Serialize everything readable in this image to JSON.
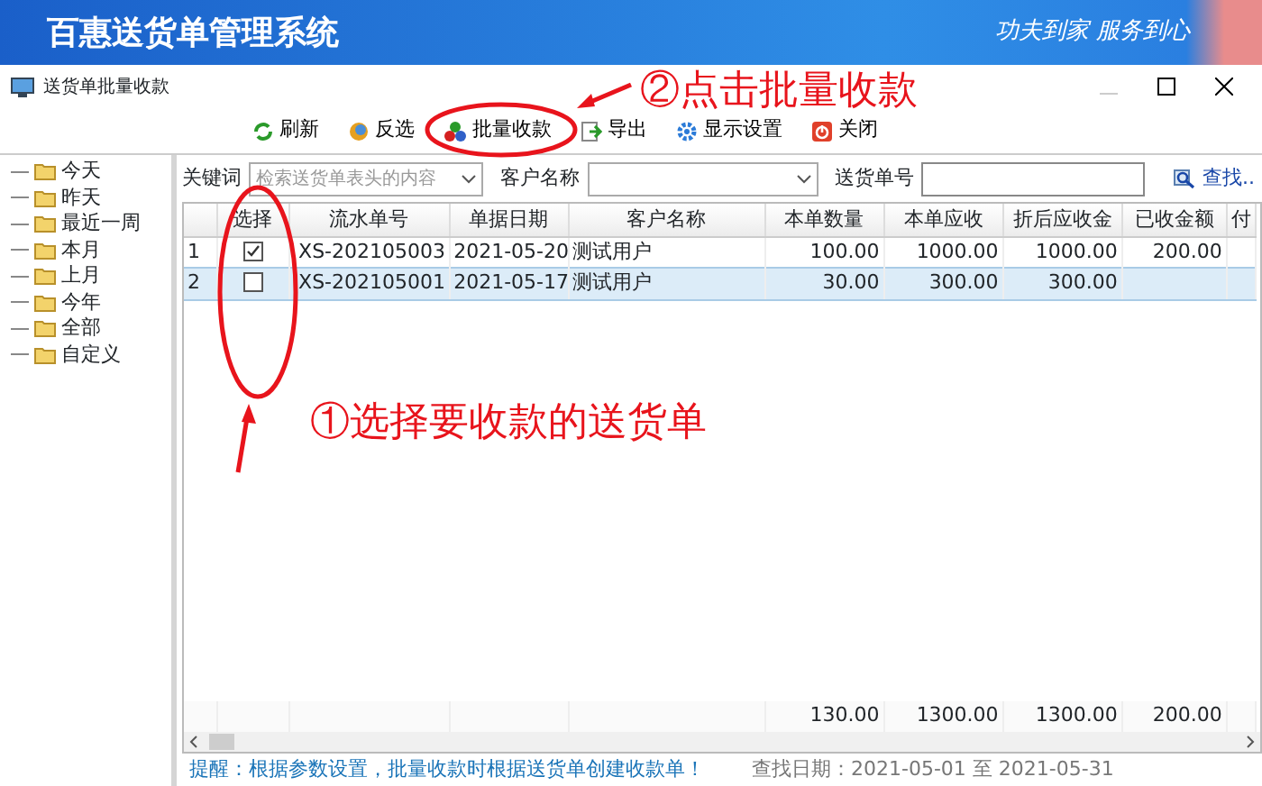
{
  "app_header": {
    "title": "百惠送货单管理系统",
    "slogan": "功夫到家 服务到心"
  },
  "window": {
    "title": "送货单批量收款"
  },
  "toolbar": [
    {
      "label": "刷新",
      "kind": "refresh"
    },
    {
      "label": "反选",
      "kind": "invert"
    },
    {
      "label": "批量收款",
      "kind": "batch"
    },
    {
      "label": "导出",
      "kind": "export"
    },
    {
      "label": "显示设置",
      "kind": "settings"
    },
    {
      "label": "关闭",
      "kind": "close"
    }
  ],
  "tree": {
    "items": [
      "今天",
      "昨天",
      "最近一周",
      "本月",
      "上月",
      "今年",
      "全部",
      "自定义"
    ]
  },
  "filters": {
    "keyword_label": "关键词",
    "keyword_placeholder": "检索送货单表头的内容",
    "customer_label": "客户名称",
    "order_label": "送货单号",
    "search_link": "查找.."
  },
  "table": {
    "columns": [
      "",
      "选择",
      "流水单号",
      "单据日期",
      "客户名称",
      "本单数量",
      "本单应收",
      "折后应收金",
      "已收金额",
      "付"
    ],
    "rows": [
      {
        "checked": true,
        "selected": false,
        "cells": [
          "1",
          "",
          "XS-202105003",
          "2021-05-20",
          "测试用户",
          "100.00",
          "1000.00",
          "1000.00",
          "200.00"
        ]
      },
      {
        "checked": false,
        "selected": true,
        "cells": [
          "2",
          "",
          "XS-202105001",
          "2021-05-17",
          "测试用户",
          "30.00",
          "300.00",
          "300.00"
        ]
      }
    ],
    "totals": {
      "quantity": "130.00",
      "receivable": "1300.00",
      "discounted_receivable": "1300.00",
      "received": "200.00"
    }
  },
  "status_bar": {
    "hint": "提醒：根据参数设置，批量收款时根据送货单创建收款单！",
    "date_range": "查找日期：2021-05-01 至 2021-05-31"
  },
  "annotations": [
    {
      "kind": "toolbar_callout",
      "text": "②点击批量收款"
    },
    {
      "kind": "column_callout",
      "text": "①选择要收款的送货单"
    }
  ]
}
